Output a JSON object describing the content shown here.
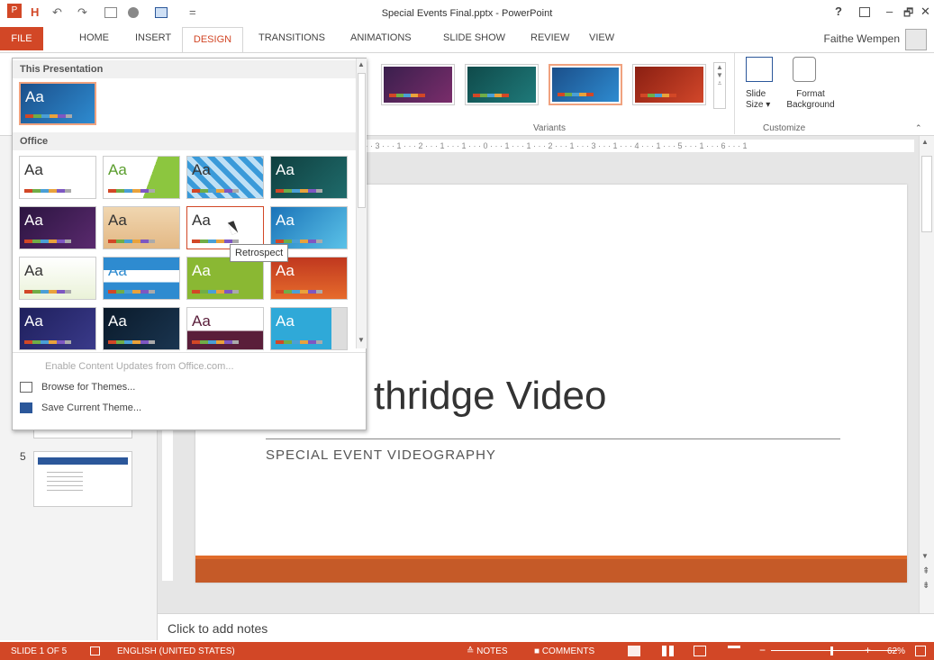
{
  "window": {
    "title": "Special Events Final.pptx - PowerPoint",
    "help": "?",
    "minimize": "–",
    "restore": "🗗",
    "close": "✕"
  },
  "qat": {
    "undo": "↶",
    "redo": "↷",
    "save": "H"
  },
  "tabs": {
    "file": "FILE",
    "home": "HOME",
    "insert": "INSERT",
    "design": "DESIGN",
    "transitions": "TRANSITIONS",
    "animations": "ANIMATIONS",
    "slideshow": "SLIDE SHOW",
    "review": "REVIEW",
    "view": "VIEW"
  },
  "user": "Faithe Wempen",
  "ribbon": {
    "variants_label": "Variants",
    "customize_label": "Customize",
    "slide_size": "Slide",
    "slide_size2": "Size",
    "format_bg": "Format",
    "format_bg2": "Background"
  },
  "gallery": {
    "this_presentation": "This Presentation",
    "office": "Office",
    "aa": "Aa",
    "enable_updates": "Enable Content Updates from Office.com...",
    "browse": "Browse for Themes...",
    "save_theme": "Save Current Theme...",
    "tooltip": "Retrospect"
  },
  "slide": {
    "title": "thridge Video",
    "subtitle": "SPECIAL EVENT VIDEOGRAPHY",
    "thumb_number": "5"
  },
  "ruler": "· · · 3 · · · 1 · · · 2 · · · 1 · · · 1 · · · 0 · · · 1 · · · 1 · · · 2 · · · 1 · · · 3 · · · 1 · · · 4 · · · 1 · · · 5 · · · 1 · · · 6 · · · 1",
  "notes_placeholder": "Click to add notes",
  "status": {
    "slide": "SLIDE 1 OF 5",
    "language": "ENGLISH (UNITED STATES)",
    "notes": "≙ NOTES",
    "comments": "■ COMMENTS",
    "zoom": "62%"
  }
}
